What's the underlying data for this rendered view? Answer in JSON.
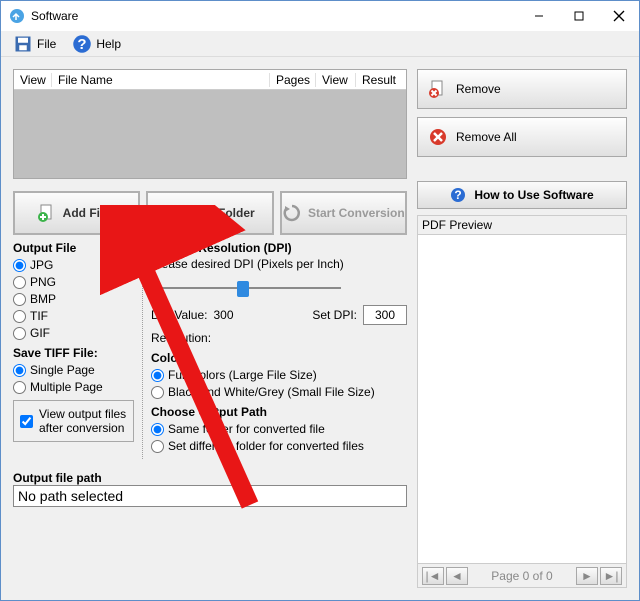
{
  "title": "Software",
  "menu": {
    "file": "File",
    "help": "Help"
  },
  "file_list_cols": {
    "view": "View",
    "file_name": "File Name",
    "pages": "Pages",
    "view2": "View",
    "result": "Result"
  },
  "side_buttons": {
    "remove": "Remove",
    "remove_all": "Remove All"
  },
  "toolbar": {
    "add_files": "Add Files",
    "add_folder": "Add Folder",
    "start_conversion": "Start Conversion"
  },
  "how_to": "How to Use Software",
  "preview": {
    "title": "PDF Preview",
    "page_label": "Page 0 of 0"
  },
  "output_file": {
    "title": "Output File",
    "jpg": "JPG",
    "png": "PNG",
    "bmp": "BMP",
    "tif": "TIF",
    "gif": "GIF"
  },
  "save_tiff": {
    "title": "Save TIFF File:",
    "single": "Single Page",
    "multiple": "Multiple Page"
  },
  "view_after": "View output files after conversion",
  "resolution": {
    "title": "Choose Resolution (DPI)",
    "desc": "Please desired DPI (Pixels per Inch)",
    "dpi_value_label": "DPI Value:",
    "dpi_value": "300",
    "set_dpi_label": "Set DPI:",
    "set_dpi": "300",
    "res_label": "Resolution:"
  },
  "colors": {
    "title": "Colors",
    "full": "Full Colors (Large File Size)",
    "bw": "Black and White/Grey (Small File Size)"
  },
  "out_path": {
    "title": "Choose Output Path",
    "same": "Same folder for converted file",
    "diff": "Set different folder for converted files"
  },
  "footer": {
    "label": "Output file path",
    "value": "No path selected"
  }
}
